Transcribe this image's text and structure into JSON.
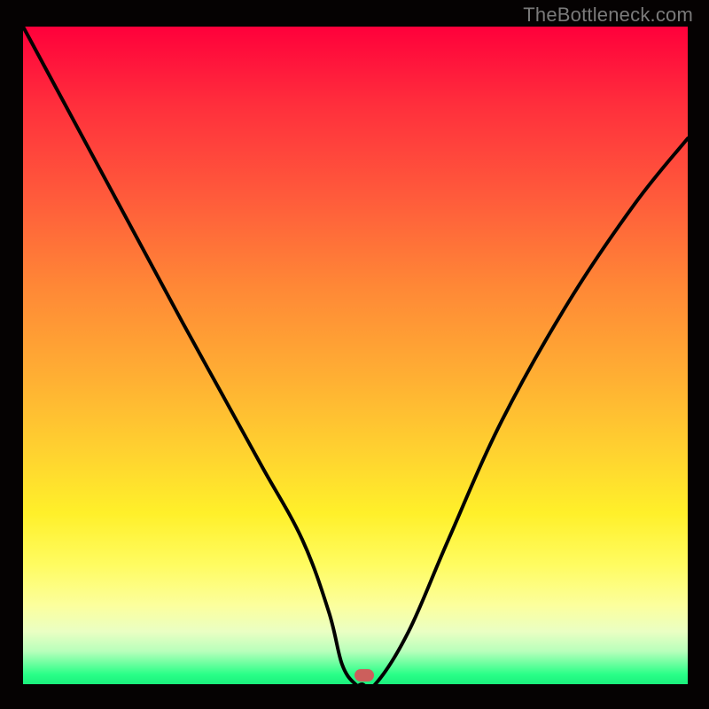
{
  "watermark": "TheBottleneck.com",
  "chart_data": {
    "type": "line",
    "title": "",
    "xlabel": "",
    "ylabel": "",
    "xlim": [
      0,
      100
    ],
    "ylim": [
      0,
      100
    ],
    "grid": false,
    "legend": false,
    "series": [
      {
        "name": "curve",
        "x": [
          0,
          8,
          16,
          24,
          30,
          36,
          42,
          46,
          48,
          50,
          51,
          53,
          58,
          64,
          72,
          82,
          92,
          100
        ],
        "y": [
          100,
          85,
          70,
          55,
          44,
          33,
          22,
          11,
          3,
          0,
          0,
          0,
          8,
          22,
          40,
          58,
          73,
          83
        ]
      }
    ],
    "marker": {
      "x": 51.3,
      "y": 0,
      "color": "#cc5f5c"
    },
    "background": "red-yellow-green vertical gradient"
  }
}
